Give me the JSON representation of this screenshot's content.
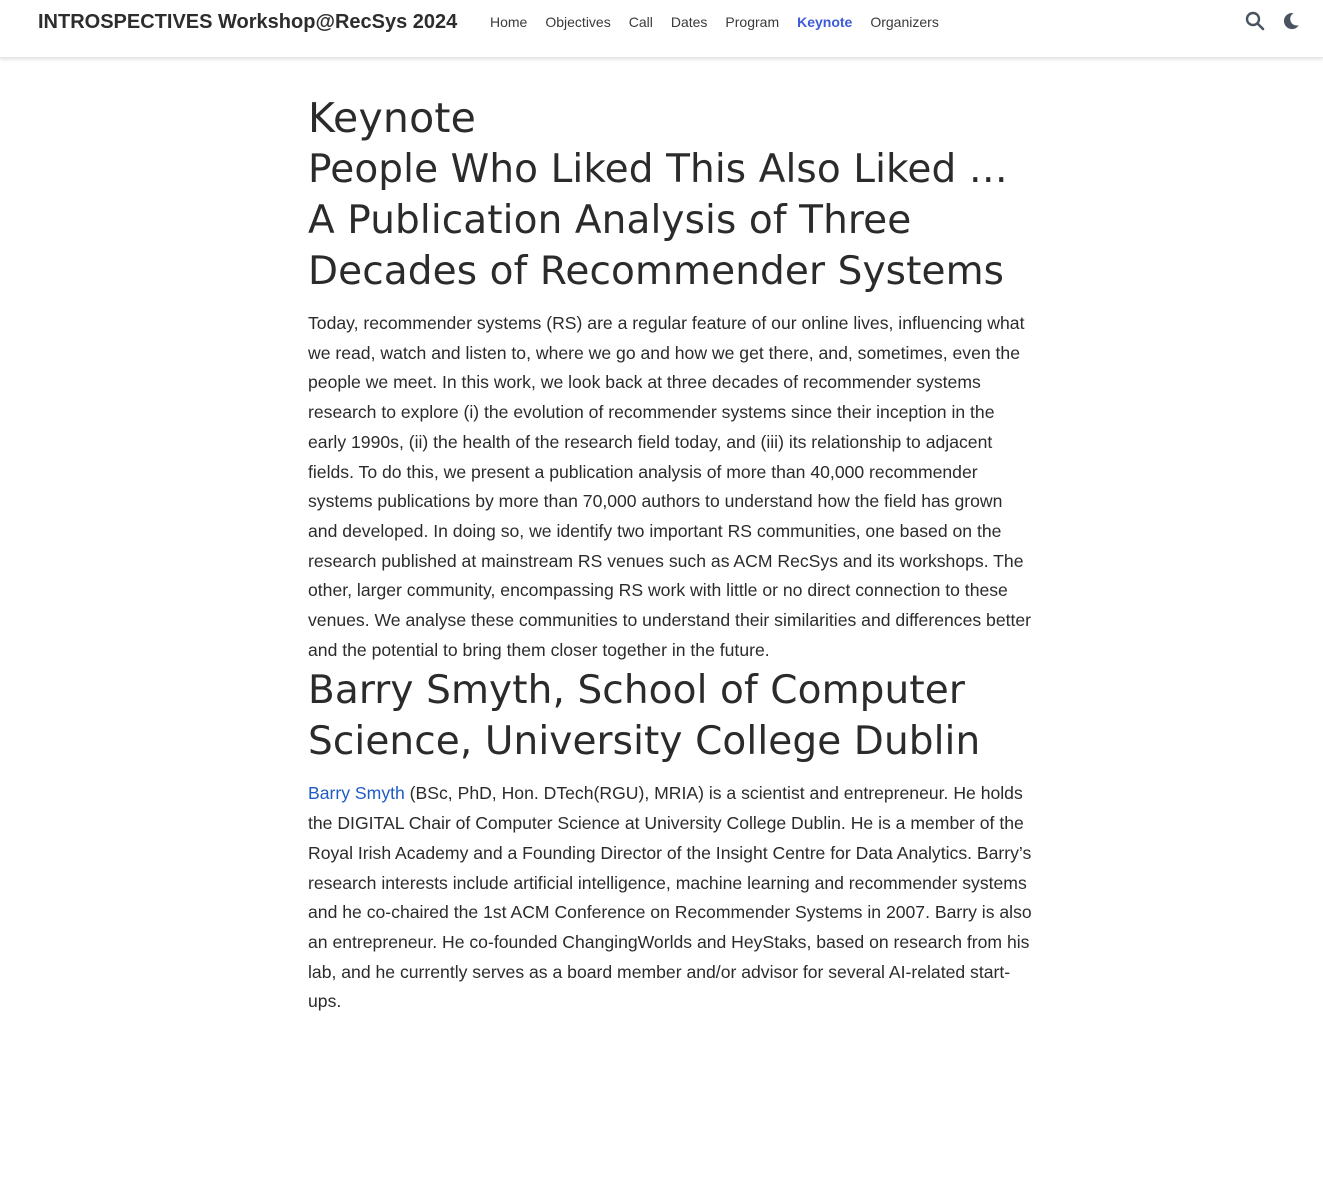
{
  "site": {
    "brand": "INTROSPECTIVES Workshop@RecSys 2024"
  },
  "nav": {
    "items": [
      {
        "label": "Home",
        "active": false
      },
      {
        "label": "Objectives",
        "active": false
      },
      {
        "label": "Call",
        "active": false
      },
      {
        "label": "Dates",
        "active": false
      },
      {
        "label": "Program",
        "active": false
      },
      {
        "label": "Keynote",
        "active": true
      },
      {
        "label": "Organizers",
        "active": false
      }
    ],
    "icons": [
      "search-icon",
      "dark-mode-moon-icon"
    ]
  },
  "colors": {
    "accent": "#3d5bd9",
    "link": "#1f5bc6",
    "text": "#2b2b2b"
  },
  "page": {
    "title": "Keynote",
    "talk_title": "People Who Liked This Also Liked … A Publication Analysis of Three Decades of Recommender Systems",
    "abstract": "Today, recommender systems (RS) are a regular feature of our online lives, influencing what we read, watch and listen to, where we go and how we get there, and, sometimes, even the people we meet. In this work, we look back at three decades of recommender systems research to explore (i) the evolution of recommender systems since their inception in the early 1990s, (ii) the health of the research field today, and (iii) its relationship to adjacent fields. To do this, we present a publication analysis of more than 40,000 recommender systems publications by more than 70,000 authors to understand how the field has grown and developed. In doing so, we identify two important RS communities, one based on the research published at mainstream RS venues such as ACM RecSys and its workshops. The other, larger community, encompassing RS work with little or no direct connection to these venues. We analyse these communities to understand their similarities and differences better and the potential to bring them closer together in the future.",
    "speaker_heading": "Barry Smyth, School of Computer Science, University College Dublin",
    "bio_link": "Barry Smyth",
    "bio_text": " (BSc, PhD, Hon. DTech(RGU), MRIA) is a scientist and entrepreneur. He holds the DIGITAL Chair of Computer Science at University College Dublin. He is a member of the Royal Irish Academy and a Founding Director of the Insight Centre for Data Analytics. Barry’s research interests include artificial intelligence, machine learning and recommender systems and he co-chaired the 1st ACM Conference on Recommender Systems in 2007. Barry is also an entrepreneur. He co-founded ChangingWorlds and HeyStaks, based on research from his lab, and he currently serves as a board member and/or advisor for several AI-related start-ups."
  }
}
